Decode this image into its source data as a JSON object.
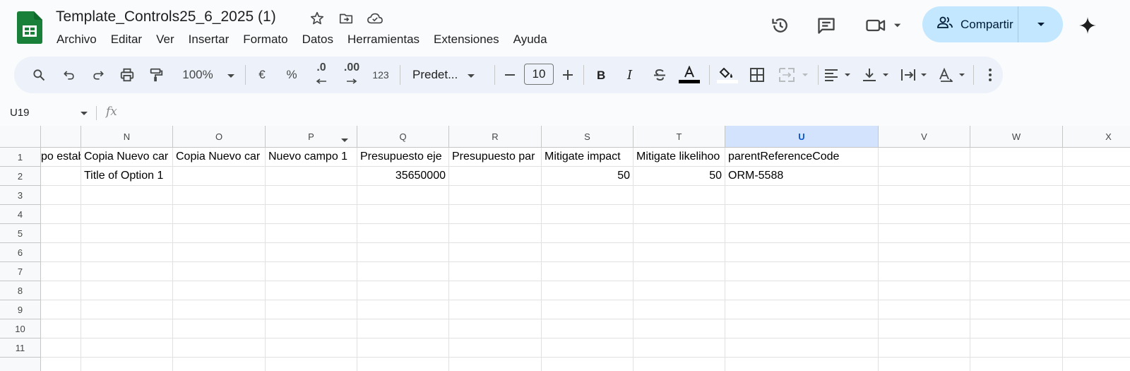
{
  "header": {
    "doc_title": "Template_Controls25_6_2025 (1)",
    "menu": [
      "Archivo",
      "Editar",
      "Ver",
      "Insertar",
      "Formato",
      "Datos",
      "Herramientas",
      "Extensiones",
      "Ayuda"
    ],
    "share_label": "Compartir",
    "icons": [
      "sheets-logo-icon",
      "star-icon",
      "move-folder-icon",
      "cloud-saved-icon",
      "version-history-icon",
      "comments-icon",
      "meet-camera-icon",
      "gemini-sparkle-icon"
    ]
  },
  "toolbar": {
    "zoom": "100%",
    "currency": "€",
    "percent": "%",
    "decrease_decimals": ".0",
    "increase_decimals": ".00",
    "more_formats": "123",
    "font": "Predet...",
    "font_size": "10"
  },
  "formula_bar": {
    "name_box": "U19",
    "fx": "fx"
  },
  "grid": {
    "columns": [
      "",
      "N",
      "O",
      "P",
      "Q",
      "R",
      "S",
      "T",
      "U",
      "V",
      "W",
      "X"
    ],
    "selected_column": "U",
    "row_numbers": [
      "1",
      "2",
      "3",
      "4",
      "5",
      "6",
      "7",
      "8",
      "9",
      "10",
      "11"
    ],
    "row1": [
      "po estab",
      "Copia Nuevo car",
      "Copia Nuevo car",
      "Nuevo campo 1",
      "Presupuesto eje",
      "Presupuesto par",
      "Mitigate impact",
      "Mitigate likelihoo",
      "parentReferenceCode",
      "",
      "",
      ""
    ],
    "row2": [
      "",
      "Title of Option 1",
      "",
      "",
      "35650000",
      "",
      "50",
      "50",
      "ORM-5588",
      "",
      "",
      ""
    ]
  },
  "colors": {
    "accent": "#0b57d0",
    "share_bg": "#c2e7ff",
    "sheets_green": "#188038",
    "toolbar_bg": "#edf2fa",
    "selected_header": "#d3e3fd"
  }
}
